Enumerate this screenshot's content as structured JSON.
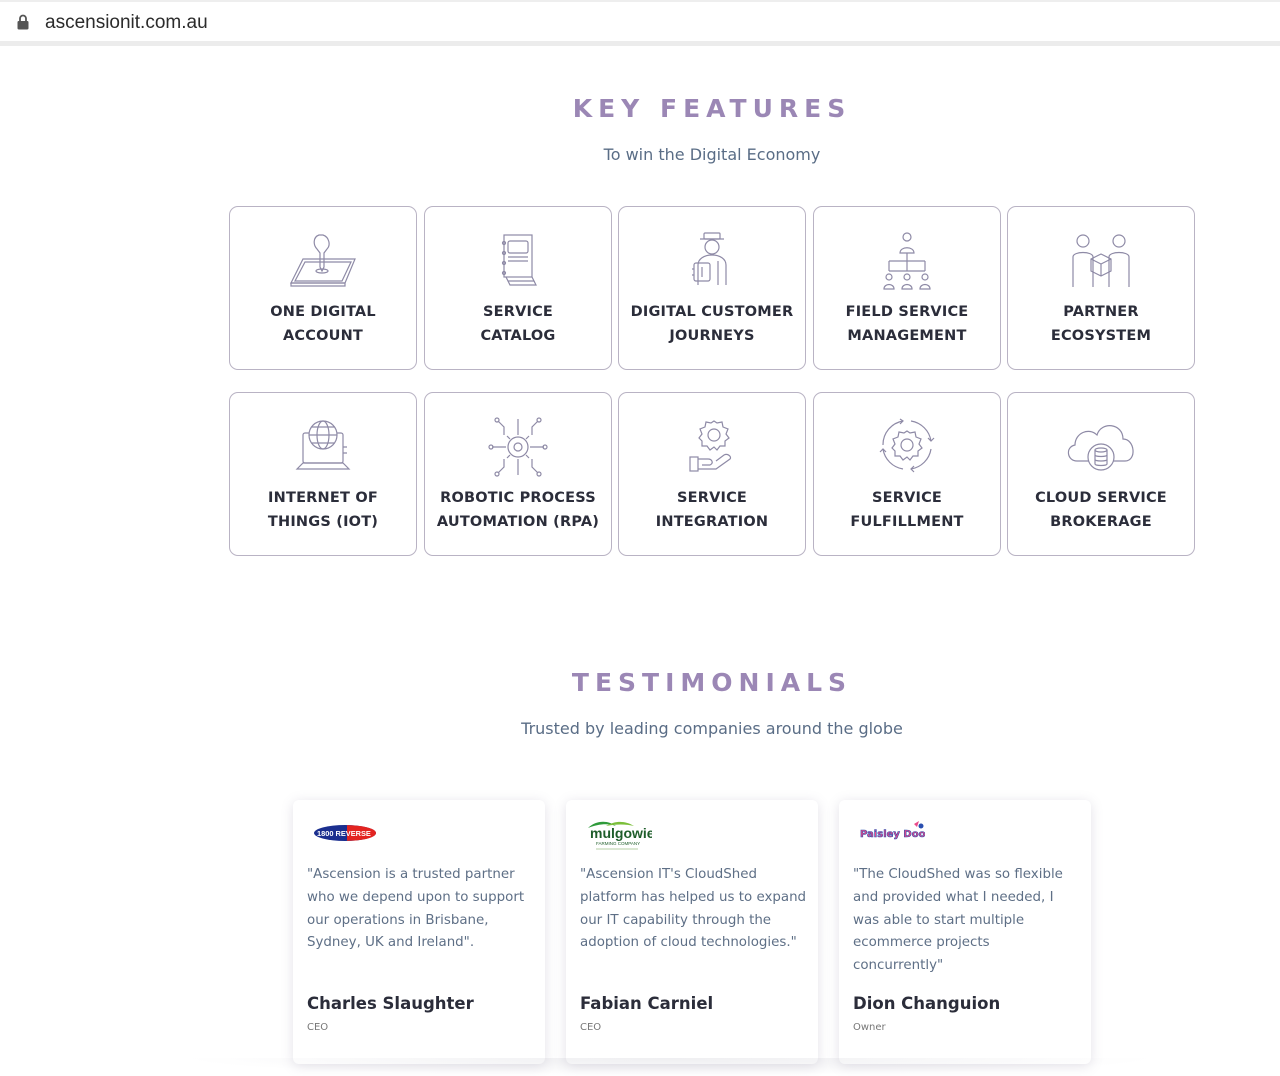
{
  "browser": {
    "url": "ascensionit.com.au"
  },
  "features": {
    "title": "KEY FEATURES",
    "subtitle": "To win the Digital Economy",
    "items": [
      {
        "line1": "ONE DIGITAL",
        "line2": "ACCOUNT",
        "icon": "tablet-touch-icon"
      },
      {
        "line1": "SERVICE",
        "line2": "CATALOG",
        "icon": "catalog-book-icon"
      },
      {
        "line1": "DIGITAL CUSTOMER",
        "line2": "JOURNEYS",
        "icon": "customer-journey-icon"
      },
      {
        "line1": "FIELD SERVICE",
        "line2": "MANAGEMENT",
        "icon": "org-chart-icon"
      },
      {
        "line1": "PARTNER",
        "line2": "ECOSYSTEM",
        "icon": "partners-box-icon"
      },
      {
        "line1": "INTERNET OF",
        "line2": "THINGS (IOT)",
        "icon": "globe-laptop-icon"
      },
      {
        "line1": "ROBOTIC PROCESS",
        "line2": "AUTOMATION (RPA)",
        "icon": "gear-network-icon"
      },
      {
        "line1": "SERVICE",
        "line2": "INTEGRATION",
        "icon": "gear-hand-icon"
      },
      {
        "line1": "SERVICE",
        "line2": "FULFILLMENT",
        "icon": "gear-cycle-icon"
      },
      {
        "line1": "CLOUD SERVICE",
        "line2": "BROKERAGE",
        "icon": "cloud-database-icon"
      }
    ]
  },
  "testimonials": {
    "title": "TESTIMONIALS",
    "subtitle": "Trusted by leading companies around the globe",
    "items": [
      {
        "logo_text": "1800 REVERSE",
        "quote": "\"Ascension is a trusted partner who we depend upon to support our operations in Brisbane, Sydney, UK and Ireland\".",
        "name": "Charles Slaughter",
        "role": "CEO"
      },
      {
        "logo_text": "mulgowie",
        "logo_sub": "FARMING COMPANY",
        "quote": "\"Ascension IT's CloudShed platform has helped us to expand our IT capability through the adoption of cloud technologies.\"",
        "name": "Fabian Carniel",
        "role": "CEO"
      },
      {
        "logo_text": "Paisley Dooo",
        "quote": "\"The CloudShed was so flexible and provided what I needed, I was able to start multiple ecommerce projects concurrently\"",
        "name": "Dion Changuion",
        "role": "Owner"
      }
    ]
  }
}
